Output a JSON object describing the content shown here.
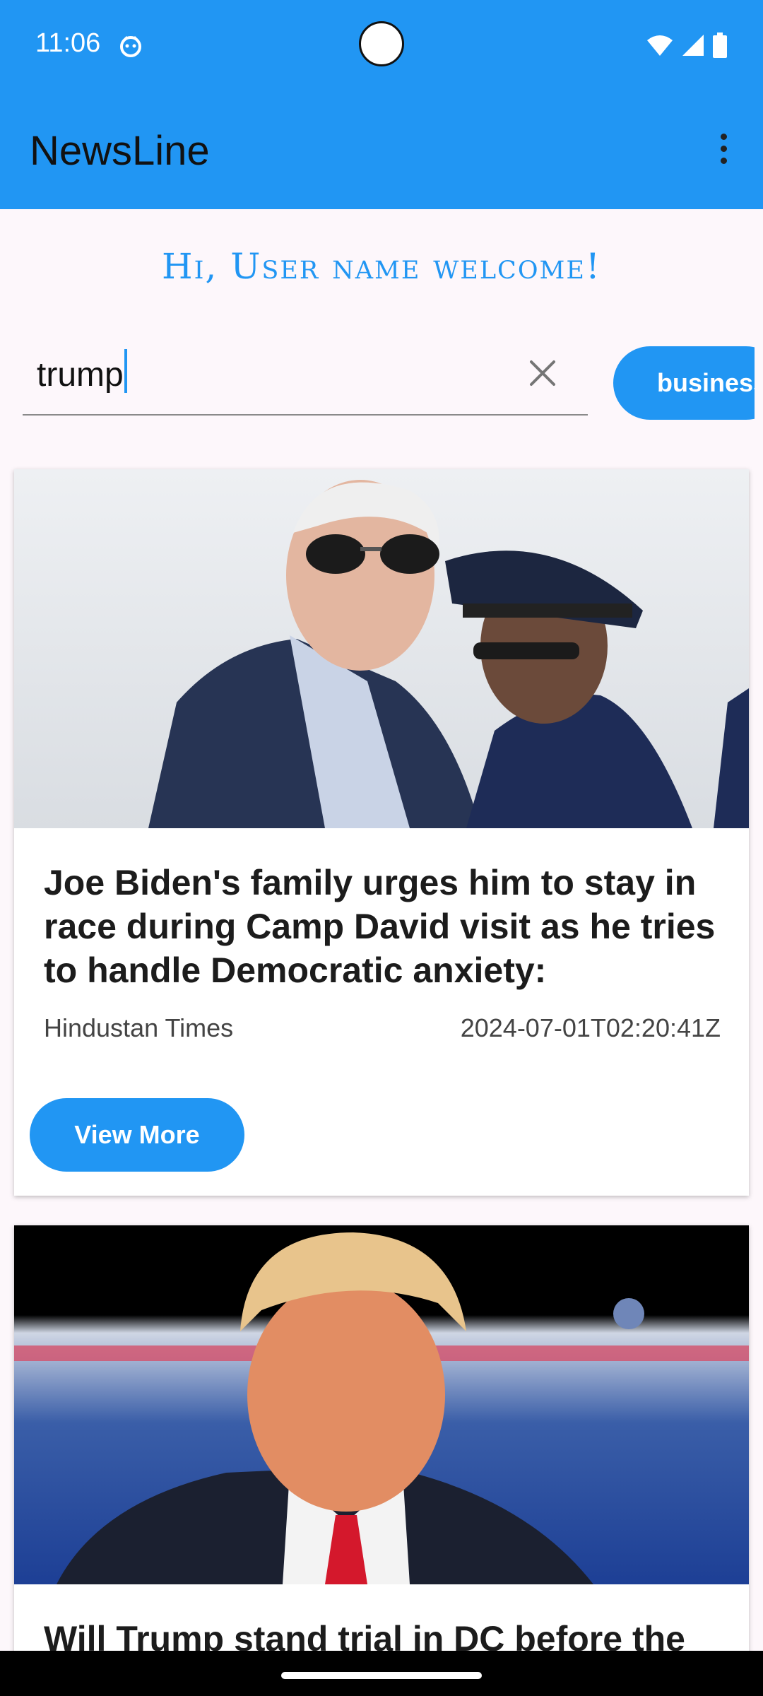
{
  "status_bar": {
    "time": "11:06",
    "icons": [
      "app-notification-icon",
      "wifi-icon",
      "signal-icon",
      "battery-icon"
    ]
  },
  "app_bar": {
    "title": "NewsLine",
    "menu_icon": "overflow-menu-icon"
  },
  "welcome_text": "Hi, User name welcome!",
  "search": {
    "value": "trump",
    "clear_icon": "close-icon"
  },
  "categories": [
    {
      "label": "business"
    }
  ],
  "articles": [
    {
      "title": "Joe Biden's family urges him to stay in race during Camp David visit as he tries to handle Democratic anxiety:",
      "source": "Hindustan Times",
      "published_at": "2024-07-01T02:20:41Z",
      "button_label": "View More"
    },
    {
      "title": "Will Trump stand trial in DC before the"
    }
  ],
  "colors": {
    "primary": "#2196f3",
    "background": "#fdf7fb",
    "text": "#1c1c1c"
  }
}
